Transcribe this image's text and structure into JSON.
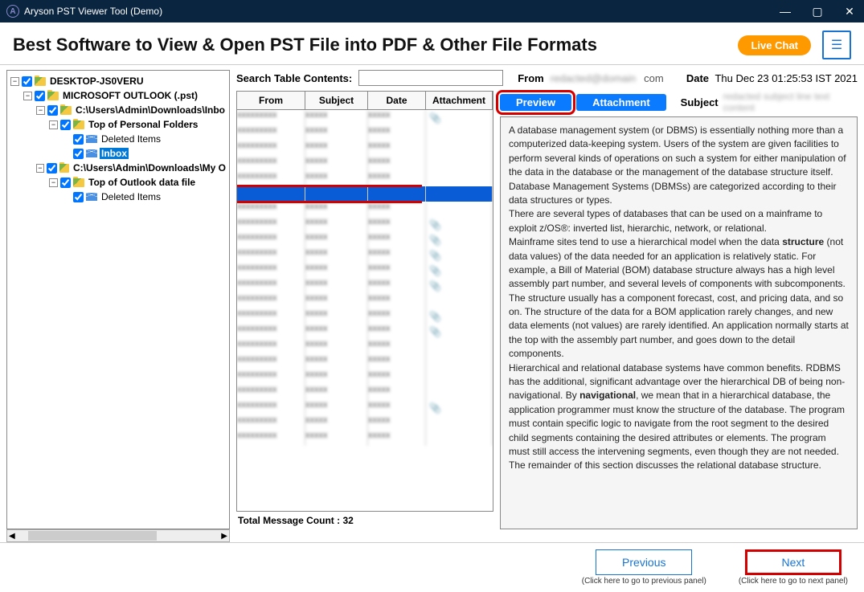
{
  "title": "Aryson PST Viewer Tool (Demo)",
  "header": {
    "headline": "Best Software to View & Open PST File into PDF & Other File Formats",
    "livechat": "Live Chat"
  },
  "tree": {
    "root": "DESKTOP-JS0VERU",
    "n1": "MICROSOFT OUTLOOK (.pst)",
    "n2": "C:\\Users\\Admin\\Downloads\\Inbo",
    "n3": "Top of Personal Folders",
    "n4": "Deleted Items",
    "n5": "Inbox",
    "n6": "C:\\Users\\Admin\\Downloads\\My O",
    "n7": "Top of Outlook data file",
    "n8": "Deleted Items"
  },
  "search": {
    "label": "Search Table Contents:",
    "value": "",
    "from_label": "From",
    "from_value": "redacted@domain",
    "from_suffix": "com",
    "date_label": "Date",
    "date_value": "Thu Dec 23 01:25:53 IST 2021"
  },
  "table": {
    "headers": {
      "from": "From",
      "subject": "Subject",
      "date": "Date",
      "attachment": "Attachment"
    },
    "msgcount": "Total Message Count : 32"
  },
  "tabs": {
    "preview": "Preview",
    "attachment": "Attachment",
    "subject_label": "Subject",
    "subject_value": "redacted subject line text content"
  },
  "preview": {
    "p1a": "A database management system (or DBMS) is essentially nothing more than a computerized data-keeping system. Users of the system are given facilities to perform several kinds of operations on such a system for either manipulation of the data in the database or the management of the database structure itself. Database Management Systems (DBMSs) are categorized according to their data structures or types.",
    "p1b": "There are several types of databases that can be used on a mainframe to exploit z/OS®: inverted list, hierarchic, network, or relational.",
    "p2a": "Mainframe sites tend to use a hierarchical model when the data ",
    "p2b": "structure",
    "p2c": " (not data values) of the data needed for an application is relatively static. For example, a Bill of Material (BOM) database structure always has a high level assembly part number, and several levels of components with subcomponents. The structure usually has a component forecast, cost, and pricing data, and so on. The structure of the data for a BOM application rarely changes, and new data elements (not values) are rarely identified. An application normally starts at the top with the assembly part number, and goes down to the detail components.",
    "p3a": "Hierarchical and relational database systems have common benefits. RDBMS has the additional, significant advantage over the hierarchical DB of being non-navigational. By ",
    "p3b": "navigational",
    "p3c": ", we mean that in a hierarchical database, the application programmer must know the structure of the database. The program must contain specific logic to navigate from the root segment to the desired child segments containing the desired attributes or elements. The program must still access the intervening segments, even though they are not needed.",
    "p4": "The remainder of this section discusses the relational database structure."
  },
  "footer": {
    "prev": "Previous",
    "prev_hint": "(Click here to go to previous panel)",
    "next": "Next",
    "next_hint": "(Click here to go to next panel)"
  }
}
